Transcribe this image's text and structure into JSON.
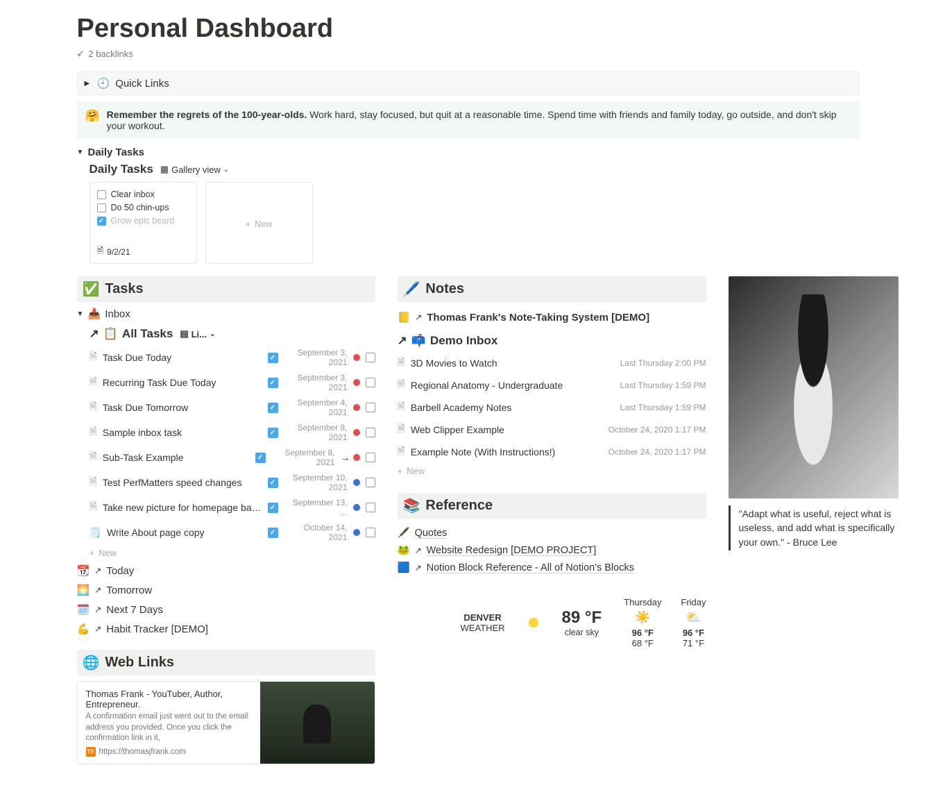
{
  "page": {
    "title": "Personal Dashboard",
    "backlinks": "2 backlinks"
  },
  "quick_links": {
    "label": "Quick Links",
    "icon": "🕘"
  },
  "callout": {
    "emoji": "🤗",
    "bold": "Remember the regrets of the 100-year-olds.",
    "rest": "Work hard, stay focused, but quit at a reasonable time. Spend time with friends and family today, go outside, and don't skip your workout."
  },
  "daily": {
    "toggle": "Daily Tasks",
    "db_title": "Daily Tasks",
    "view": "Gallery view",
    "card": {
      "items": [
        {
          "label": "Clear inbox",
          "done": false
        },
        {
          "label": "Do 50 chin-ups",
          "done": false
        },
        {
          "label": "Grow epic beard",
          "done": true
        }
      ],
      "date": "9/2/21"
    },
    "new": "New"
  },
  "tasks": {
    "header": "Tasks",
    "header_icon": "✅",
    "inbox": {
      "icon": "📥",
      "label": "Inbox"
    },
    "all_tasks": {
      "icon": "📋",
      "label": "All Tasks",
      "view": "Li..."
    },
    "rows": [
      {
        "name": "Task Due Today",
        "date": "September 3, 2021",
        "dot": "red"
      },
      {
        "name": "Recurring Task Due Today",
        "date": "September 3, 2021",
        "dot": "red"
      },
      {
        "name": "Task Due Tomorrow",
        "date": "September 4, 2021",
        "dot": "red"
      },
      {
        "name": "Sample inbox task",
        "date": "September 8, 2021",
        "dot": "red"
      },
      {
        "name": "Sub-Task Example",
        "date": "September 8, 2021",
        "dot": "red",
        "arrow": true,
        "shift": true
      },
      {
        "name": "Test PerfMatters speed changes",
        "date": "September 10, 2021",
        "dot": "blue"
      },
      {
        "name": "Take new picture for homepage bac...",
        "date": "September 13, ...",
        "dot": "blue"
      },
      {
        "name": "Write About page copy",
        "date": "October 14, 2021",
        "dot": "blue",
        "icon": "🗒️"
      }
    ],
    "addnew": "New",
    "links": [
      {
        "icon": "📆",
        "label": "Today"
      },
      {
        "icon": "🌅",
        "label": "Tomorrow"
      },
      {
        "icon": "🗓️",
        "label": "Next 7 Days"
      },
      {
        "icon": "💪",
        "label": "Habit Tracker [DEMO]"
      }
    ]
  },
  "weblinks": {
    "header": "Web Links",
    "header_icon": "🌐",
    "card": {
      "title": "Thomas Frank - YouTuber, Author, Entrepreneur.",
      "desc": "A confirmation email just went out to the email address you provided. Once you click the confirmation link in it,",
      "url": "https://thomasjfrank.com",
      "fav": "TF"
    }
  },
  "notes": {
    "header": "Notes",
    "header_icon": "🖊️",
    "top_link": {
      "icon": "📒",
      "label": "Thomas Frank's Note-Taking System [DEMO]"
    },
    "demo_inbox": {
      "icon": "📫",
      "label": "Demo Inbox"
    },
    "rows": [
      {
        "name": "3D Movies to Watch",
        "meta": "Last Thursday 2:00 PM"
      },
      {
        "name": "Regional Anatomy - Undergraduate",
        "meta": "Last Thursday 1:59 PM"
      },
      {
        "name": "Barbell Academy Notes",
        "meta": "Last Thursday 1:59 PM"
      },
      {
        "name": "Web Clipper Example",
        "meta": "October 24, 2020 1:17 PM"
      },
      {
        "name": "Example Note (With Instructions!)",
        "meta": "October 24, 2020 1:17 PM"
      }
    ],
    "addnew": "New"
  },
  "reference": {
    "header": "Reference",
    "header_icon": "📚",
    "rows": [
      {
        "icon": "🖋️",
        "label": "Quotes",
        "link": false
      },
      {
        "icon": "🐸",
        "label": "Website Redesign [DEMO PROJECT]",
        "link": true
      },
      {
        "icon": "🟦",
        "label": "Notion Block Reference - All of Notion's Blocks",
        "link": true
      }
    ]
  },
  "quote": {
    "text": "\"Adapt what is useful, reject what is useless, and add what is specifically your own.\" - Bruce Lee"
  },
  "weather": {
    "loc1": "DENVER",
    "loc2": "WEATHER",
    "now_temp": "89 °F",
    "now_cond": "clear sky",
    "days": [
      {
        "label": "Thursday",
        "icon": "☀️",
        "hi": "96 °F",
        "lo": "68 °F"
      },
      {
        "label": "Friday",
        "icon": "⛅",
        "hi": "96 °F",
        "lo": "71 °F"
      }
    ]
  }
}
